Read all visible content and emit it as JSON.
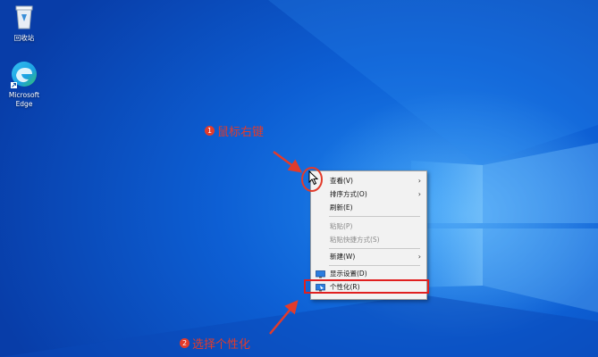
{
  "desktop": {
    "icons": [
      {
        "name": "recycle-bin",
        "label": "回收站"
      },
      {
        "name": "microsoft-edge",
        "label": "Microsoft Edge"
      }
    ]
  },
  "context_menu": {
    "items": [
      {
        "label": "查看(V)",
        "has_submenu": true,
        "enabled": true
      },
      {
        "label": "排序方式(O)",
        "has_submenu": true,
        "enabled": true
      },
      {
        "label": "刷新(E)",
        "has_submenu": false,
        "enabled": true
      },
      {
        "label": "粘贴(P)",
        "has_submenu": false,
        "enabled": false
      },
      {
        "label": "粘贴快捷方式(S)",
        "has_submenu": false,
        "enabled": false
      },
      {
        "label": "新建(W)",
        "has_submenu": true,
        "enabled": true
      },
      {
        "label": "显示设置(D)",
        "has_submenu": false,
        "enabled": true,
        "icon": "display-icon"
      },
      {
        "label": "个性化(R)",
        "has_submenu": false,
        "enabled": true,
        "icon": "personalize-icon"
      }
    ],
    "submenu_arrow": "›"
  },
  "annotations": {
    "step1": {
      "number": "1",
      "text": "鼠标右键"
    },
    "step2": {
      "number": "2",
      "text": "选择个性化"
    }
  },
  "colors": {
    "annotation_red": "#e23b2b",
    "highlight_red": "#e02020",
    "desktop_blue": "#0d5fd4",
    "menu_bg": "#f2f2f2"
  }
}
